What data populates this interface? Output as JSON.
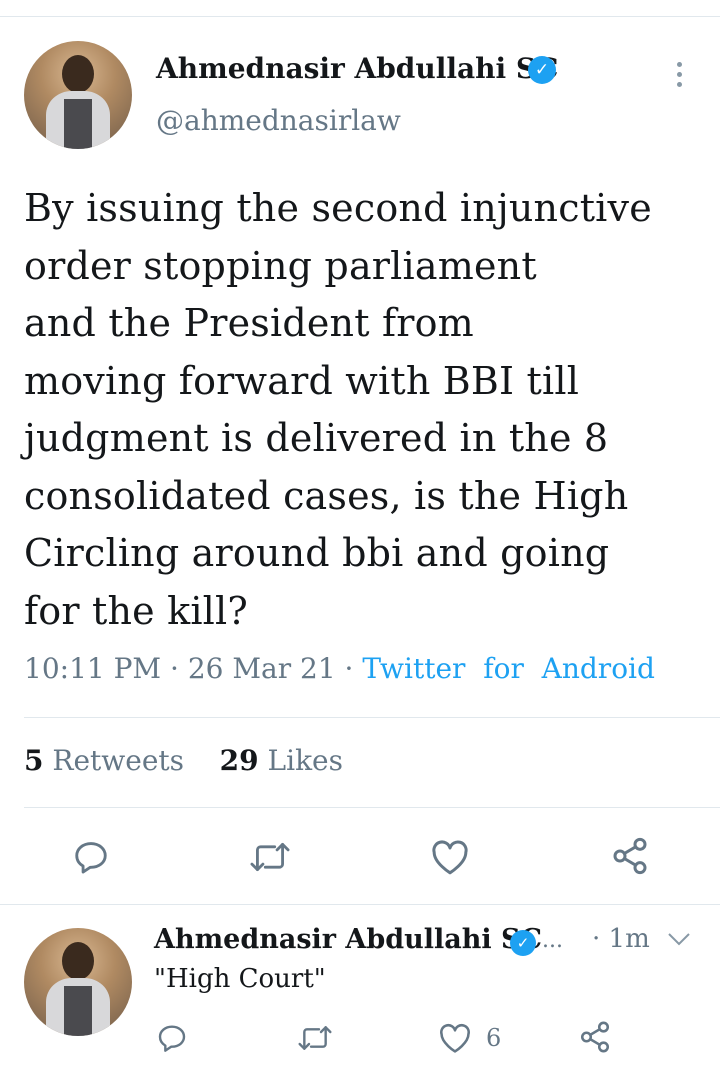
{
  "tweet": {
    "author_name": "Ahmednasir Abdullahi SC",
    "handle": "@ahmednasirlaw",
    "text_lines": [
      "By issuing the second injunctive",
      "order stopping parliament",
      "and the President from",
      "moving forward with BBI till",
      "judgment is delivered in the 8",
      "consolidated cases, is the High",
      "Circling around bbi and going",
      "for the kill?"
    ],
    "time": "10:11 PM",
    "date": "26 Mar 21",
    "source": "Twitter  for  Android",
    "separator": "·",
    "retweets_count": "5",
    "retweets_label": "Retweets",
    "likes_count": "29",
    "likes_label": "Likes"
  },
  "reply": {
    "author_name": "Ahmednasir Abdullahi SC",
    "ellipsis": "...",
    "time": "· 1m",
    "text": "\"High Court\"",
    "likes_count": "6"
  },
  "icons": {
    "reply": "reply-icon",
    "retweet": "retweet-icon",
    "like": "heart-icon",
    "share": "share-icon",
    "verified": "verified-badge-icon",
    "more": "more-vertical-icon",
    "caret": "chevron-down-icon"
  },
  "colors": {
    "accent": "#1da1f2",
    "secondary_text": "#657786",
    "divider": "#e1e8ed"
  }
}
